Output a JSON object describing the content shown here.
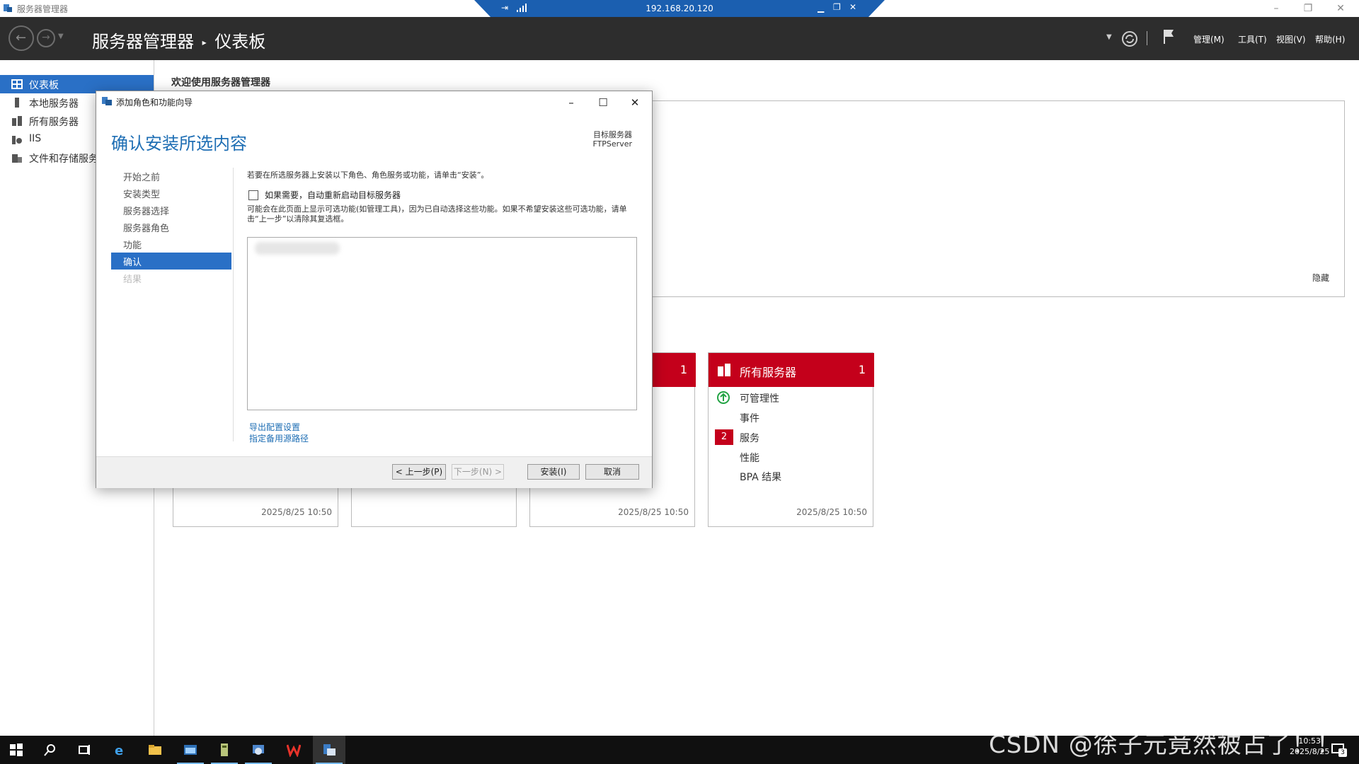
{
  "window": {
    "title": "服务器管理器"
  },
  "rdp": {
    "ip": "192.168.20.120"
  },
  "header": {
    "breadcrumb_root": "服务器管理器",
    "breadcrumb_sep": "▸",
    "breadcrumb_page": "仪表板",
    "menus": [
      "管理(M)",
      "工具(T)",
      "视图(V)",
      "帮助(H)"
    ]
  },
  "sidebar": {
    "items": [
      {
        "label": "仪表板",
        "icon": "dashboard-icon",
        "active": true
      },
      {
        "label": "本地服务器",
        "icon": "local-server-icon"
      },
      {
        "label": "所有服务器",
        "icon": "all-servers-icon"
      },
      {
        "label": "IIS",
        "icon": "iis-icon"
      },
      {
        "label": "文件和存储服务",
        "icon": "file-storage-icon"
      }
    ]
  },
  "main": {
    "welcome": "欢迎使用服务器管理器",
    "hide_label": "隐藏",
    "tiles": [
      {
        "date": "2025/8/25 10:50"
      },
      {
        "date": ""
      },
      {
        "count": "1",
        "date": "2025/8/25 10:50"
      },
      {
        "name": "所有服务器",
        "count": "1",
        "rows": [
          "可管理性",
          "事件",
          "服务",
          "性能",
          "BPA 结果"
        ],
        "services_badge": "2",
        "date": "2025/8/25 10:50"
      }
    ]
  },
  "dialog": {
    "title": "添加角色和功能向导",
    "heading": "确认安装所选内容",
    "target_label": "目标服务器",
    "target_server": "FTPServer",
    "steps": [
      "开始之前",
      "安装类型",
      "服务器选择",
      "服务器角色",
      "功能",
      "确认",
      "结果"
    ],
    "active_step": "确认",
    "instruction": "若要在所选服务器上安装以下角色、角色服务或功能，请单击“安装”。",
    "checkbox_label": "如果需要，自动重新启动目标服务器",
    "checkbox_checked": false,
    "note": "可能会在此页面上显示可选功能(如管理工具)，因为已自动选择这些功能。如果不希望安装这些可选功能，请单击“上一步”以清除其复选框。",
    "links": [
      "导出配置设置",
      "指定备用源路径"
    ],
    "buttons": {
      "prev": "< 上一步(P)",
      "next": "下一步(N) >",
      "install": "安装(I)",
      "cancel": "取消"
    }
  },
  "taskbar": {
    "items": [
      "start-icon",
      "search-icon",
      "task-view-icon",
      "ie-icon",
      "file-explorer-icon",
      "cmd-icon",
      "server-icon",
      "tools-icon",
      "wps-icon",
      "server-manager-icon"
    ],
    "time": "10:53",
    "date": "2025/8/25",
    "notifications": "3"
  },
  "watermark": "CSDN @徐子元竟然被占了！！"
}
